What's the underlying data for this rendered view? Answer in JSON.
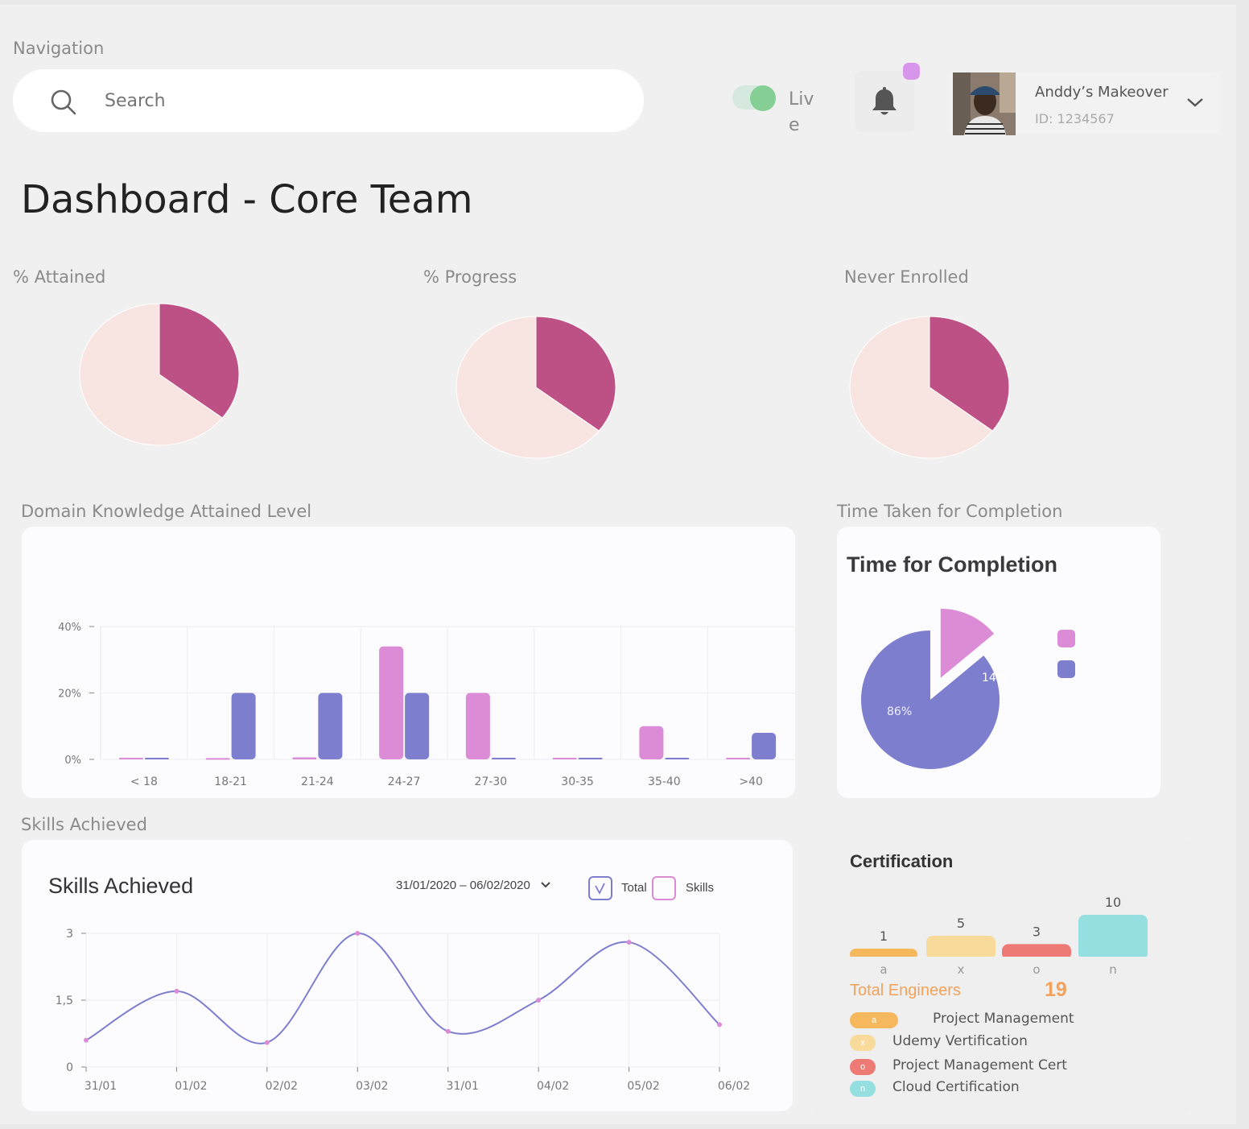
{
  "nav": {
    "label": "Navigation",
    "search_placeholder": "Search",
    "live_label": "Live",
    "notification_icon": "bell-icon",
    "user": {
      "name": "Anddy’s Makeover",
      "id": "ID: 1234567"
    }
  },
  "page_title": "Dashboard - Core Team",
  "colors": {
    "accent": "#bd5186",
    "pale": "#f8e5e2",
    "purple": "#7e7ecf",
    "pink": "#dc8cd6"
  },
  "chart_data": [
    {
      "type": "pie",
      "title": "% Attained",
      "slices": [
        {
          "value": 35.5,
          "color": "#bd5186"
        },
        {
          "value": 64.5,
          "color": "#f8e5e2"
        }
      ]
    },
    {
      "type": "pie",
      "title": "% Progress",
      "slices": [
        {
          "value": 35.5,
          "color": "#bd5186"
        },
        {
          "value": 64.5,
          "color": "#f8e5e2"
        }
      ]
    },
    {
      "type": "pie",
      "title": "Never Enrolled",
      "slices": [
        {
          "value": 35.5,
          "color": "#bd5186"
        },
        {
          "value": 64.5,
          "color": "#f8e5e2"
        }
      ]
    },
    {
      "type": "bar",
      "title": "Domain Knowledge Attained Level",
      "categories": [
        "< 18",
        "18-21",
        "21-24",
        "24-27",
        "27-30",
        "30-35",
        "35-40",
        ">40"
      ],
      "series": [
        {
          "color": "#dc8cd6",
          "values": [
            0.5,
            0.4,
            0.6,
            34,
            20,
            0.5,
            10,
            0.5
          ]
        },
        {
          "color": "#7e7ecf",
          "values": [
            0.5,
            20,
            20,
            20,
            0.5,
            0.5,
            0.5,
            8
          ]
        }
      ],
      "yticks": [
        "0%",
        "20%",
        "40%"
      ],
      "ylim": [
        0,
        40
      ]
    },
    {
      "type": "pie",
      "title": "Time for Completion",
      "section_label": "Time Taken for Completion",
      "slices": [
        {
          "value": 86,
          "label": "86%",
          "color": "#7e7ecf"
        },
        {
          "value": 14,
          "label": "14%",
          "color": "#dc8cd6"
        }
      ]
    },
    {
      "type": "line",
      "title": "Skills Achieved",
      "section_label": "Skills Achieved",
      "date_range": "31/01/2020 – 06/02/2020",
      "legend": [
        "Total",
        "Skills"
      ],
      "x": [
        "31/01",
        "01/02",
        "02/02",
        "03/02",
        "31/01",
        "04/02",
        "05/02",
        "06/02"
      ],
      "values": [
        0.6,
        1.7,
        0.55,
        3.0,
        0.8,
        1.5,
        2.8,
        0.95
      ],
      "yticks": [
        "0",
        "1,5",
        "3"
      ],
      "ylim": [
        0,
        3
      ]
    },
    {
      "type": "bar",
      "title": "Certification",
      "categories": [
        "a",
        "x",
        "o",
        "n"
      ],
      "values": [
        1,
        5,
        3,
        10
      ],
      "colors": [
        "#f5b85c",
        "#f8db9a",
        "#ee7a75",
        "#95dfe1"
      ],
      "legend": [
        "Project Management",
        "Udemy Vertification",
        "Project Management Cert",
        "Cloud Certification"
      ],
      "total_label": "Total Engineers",
      "total_value": "19"
    }
  ]
}
